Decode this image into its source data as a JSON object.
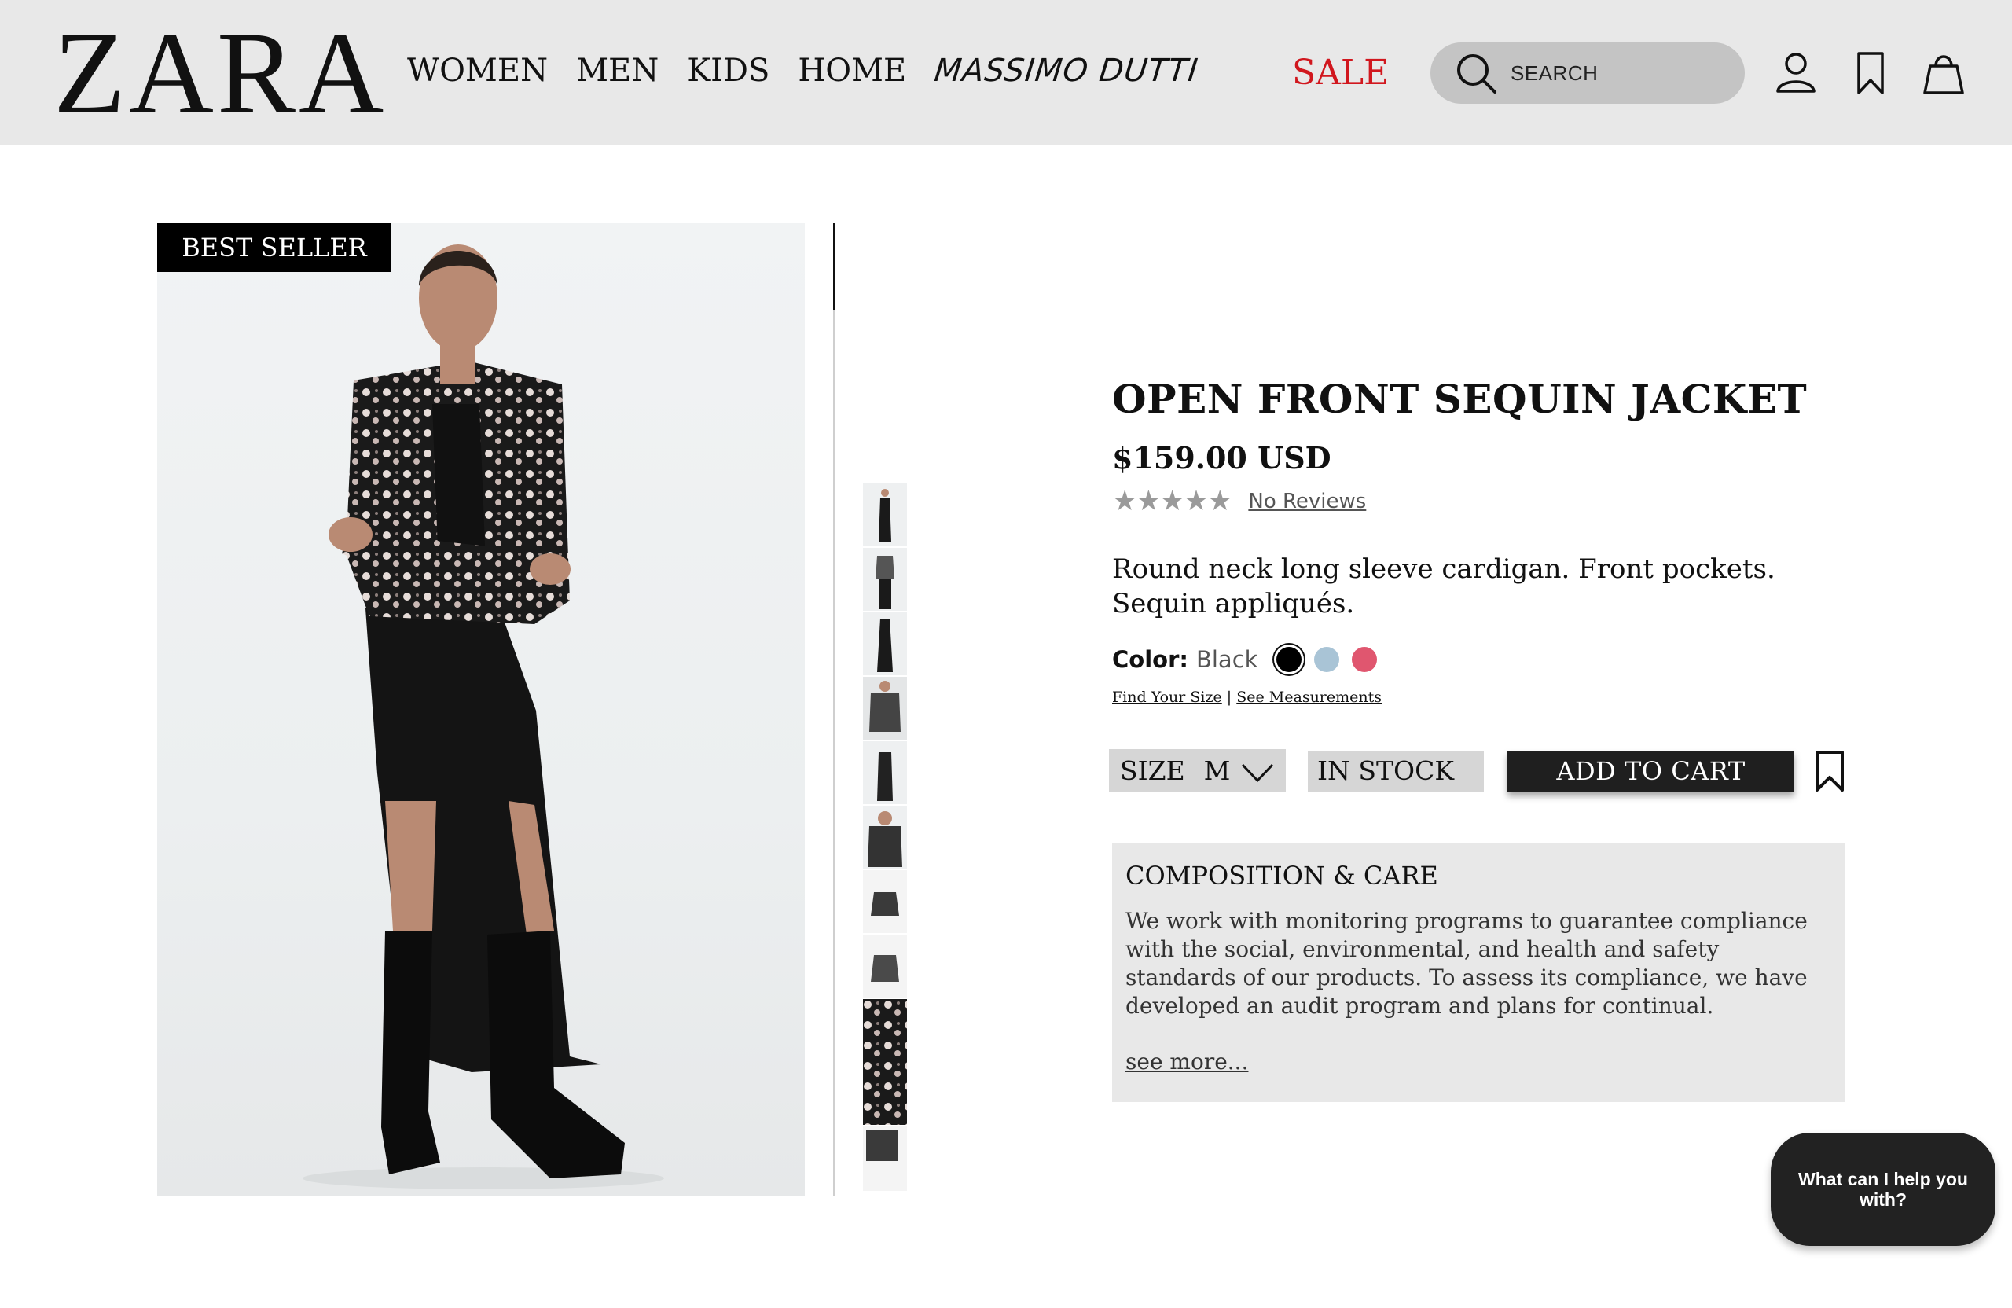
{
  "header": {
    "logo": "ZARA",
    "nav": [
      "WOMEN",
      "MEN",
      "KIDS",
      "HOME"
    ],
    "brand_link": "MASSIMO DUTTI",
    "sale": "SALE",
    "search_placeholder": "SEARCH",
    "icons": [
      "search-icon",
      "account-icon",
      "bookmark-icon",
      "shopping-bag-icon"
    ]
  },
  "gallery": {
    "badge": "BEST SELLER",
    "thumbnail_count": 11,
    "active_thumbnail": 1
  },
  "product": {
    "title": "OPEN FRONT SEQUIN JACKET",
    "price": "$159.00 USD",
    "stars": "★★★★★",
    "rating_value": 0,
    "reviews_link": "No Reviews",
    "description": "Round neck long sleeve cardigan. Front pockets. Sequin appliqués.",
    "color_label": "Color:",
    "color_value": "Black",
    "swatches": [
      {
        "name": "black",
        "hex": "#000000",
        "selected": true
      },
      {
        "name": "light-blue",
        "hex": "#a9c4d6",
        "selected": false
      },
      {
        "name": "pink",
        "hex": "#e0566f",
        "selected": false
      }
    ],
    "find_size_link": "Find Your Size",
    "separator": "|",
    "measurements_link": "See Measurements",
    "size_label": "SIZE",
    "size_value": "M",
    "stock": "IN STOCK",
    "add_to_cart": "ADD TO CART"
  },
  "care": {
    "title": "COMPOSITION & CARE",
    "text": "We work with monitoring programs to guarantee compliance with the social, environmental, and health and safety standards of our products. To assess its compliance, we have developed an audit program and plans for continual.",
    "more": "see more..."
  },
  "chat": {
    "label": "What can I help you with?"
  },
  "colors": {
    "header_bg": "#e8e8e8",
    "sale": "#d1171e",
    "button_dark": "#1f1f1f",
    "panel_bg": "#e8e8e8"
  }
}
